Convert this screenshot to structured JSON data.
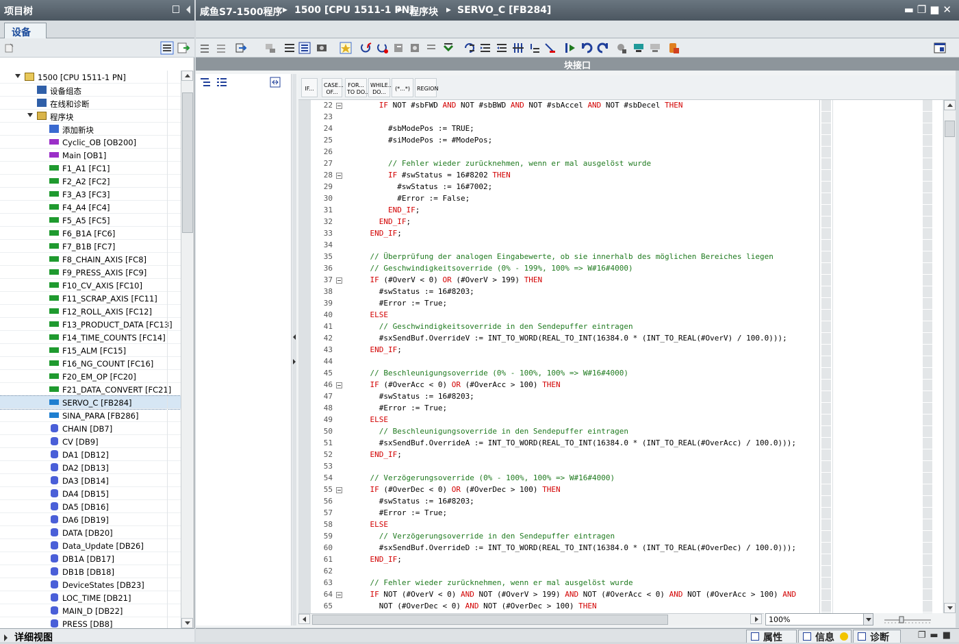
{
  "left_panel": {
    "title": "项目树",
    "tab": "设备",
    "details_label": "详细视图",
    "tree": [
      {
        "label": "1500 [CPU 1511-1 PN]",
        "level": 0,
        "icon": "plc-icon",
        "color": "#e8c85a",
        "expand": true
      },
      {
        "label": "设备组态",
        "level": 1,
        "icon": "device-config-icon",
        "color": "#2f5fa8"
      },
      {
        "label": "在线和诊断",
        "level": 1,
        "icon": "online-diag-icon",
        "color": "#2f5fa8"
      },
      {
        "label": "程序块",
        "level": 1,
        "icon": "folder-icon",
        "color": "#d9b44a",
        "expand": true
      },
      {
        "label": "添加新块",
        "level": 2,
        "icon": "add-block-icon",
        "color": "#3a6ad0"
      },
      {
        "label": "Cyclic_OB [OB200]",
        "level": 2,
        "icon": "ob-icon",
        "color": "#9b2fc8"
      },
      {
        "label": "Main [OB1]",
        "level": 2,
        "icon": "ob-icon",
        "color": "#9b2fc8"
      },
      {
        "label": "F1_A1 [FC1]",
        "level": 2,
        "icon": "fc-icon",
        "color": "#1f9a2f"
      },
      {
        "label": "F2_A2 [FC2]",
        "level": 2,
        "icon": "fc-icon",
        "color": "#1f9a2f"
      },
      {
        "label": "F3_A3 [FC3]",
        "level": 2,
        "icon": "fc-icon",
        "color": "#1f9a2f"
      },
      {
        "label": "F4_A4 [FC4]",
        "level": 2,
        "icon": "fc-icon",
        "color": "#1f9a2f"
      },
      {
        "label": "F5_A5 [FC5]",
        "level": 2,
        "icon": "fc-icon",
        "color": "#1f9a2f"
      },
      {
        "label": "F6_B1A [FC6]",
        "level": 2,
        "icon": "fc-icon",
        "color": "#1f9a2f"
      },
      {
        "label": "F7_B1B [FC7]",
        "level": 2,
        "icon": "fc-icon",
        "color": "#1f9a2f"
      },
      {
        "label": "F8_CHAIN_AXIS [FC8]",
        "level": 2,
        "icon": "fc-icon",
        "color": "#1f9a2f"
      },
      {
        "label": "F9_PRESS_AXIS [FC9]",
        "level": 2,
        "icon": "fc-icon",
        "color": "#1f9a2f"
      },
      {
        "label": "F10_CV_AXIS [FC10]",
        "level": 2,
        "icon": "fc-icon",
        "color": "#1f9a2f"
      },
      {
        "label": "F11_SCRAP_AXIS [FC11]",
        "level": 2,
        "icon": "fc-icon",
        "color": "#1f9a2f"
      },
      {
        "label": "F12_ROLL_AXIS [FC12]",
        "level": 2,
        "icon": "fc-icon",
        "color": "#1f9a2f"
      },
      {
        "label": "F13_PRODUCT_DATA [FC13]",
        "level": 2,
        "icon": "fc-icon",
        "color": "#1f9a2f"
      },
      {
        "label": "F14_TIME_COUNTS [FC14]",
        "level": 2,
        "icon": "fc-icon",
        "color": "#1f9a2f"
      },
      {
        "label": "F15_ALM [FC15]",
        "level": 2,
        "icon": "fc-icon",
        "color": "#1f9a2f"
      },
      {
        "label": "F16_NG_COUNT [FC16]",
        "level": 2,
        "icon": "fc-icon",
        "color": "#1f9a2f"
      },
      {
        "label": "F20_EM_OP [FC20]",
        "level": 2,
        "icon": "fc-icon",
        "color": "#1f9a2f"
      },
      {
        "label": "F21_DATA_CONVERT [FC21]",
        "level": 2,
        "icon": "fc-icon",
        "color": "#1f9a2f"
      },
      {
        "label": "SERVO_C [FB284]",
        "level": 2,
        "icon": "fb-icon",
        "color": "#1f7fd0",
        "selected": true
      },
      {
        "label": "SINA_PARA [FB286]",
        "level": 2,
        "icon": "fb-icon",
        "color": "#1f7fd0"
      },
      {
        "label": "CHAIN [DB7]",
        "level": 2,
        "icon": "db-icon",
        "color": "#4a5fd8"
      },
      {
        "label": "CV [DB9]",
        "level": 2,
        "icon": "db-icon",
        "color": "#4a5fd8"
      },
      {
        "label": "DA1 [DB12]",
        "level": 2,
        "icon": "db-icon",
        "color": "#4a5fd8"
      },
      {
        "label": "DA2 [DB13]",
        "level": 2,
        "icon": "db-icon",
        "color": "#4a5fd8"
      },
      {
        "label": "DA3 [DB14]",
        "level": 2,
        "icon": "db-icon",
        "color": "#4a5fd8"
      },
      {
        "label": "DA4 [DB15]",
        "level": 2,
        "icon": "db-icon",
        "color": "#4a5fd8"
      },
      {
        "label": "DA5 [DB16]",
        "level": 2,
        "icon": "db-icon",
        "color": "#4a5fd8"
      },
      {
        "label": "DA6 [DB19]",
        "level": 2,
        "icon": "db-icon",
        "color": "#4a5fd8"
      },
      {
        "label": "DATA [DB20]",
        "level": 2,
        "icon": "db-icon",
        "color": "#4a5fd8"
      },
      {
        "label": "Data_Update [DB26]",
        "level": 2,
        "icon": "db-icon",
        "color": "#4a5fd8"
      },
      {
        "label": "DB1A [DB17]",
        "level": 2,
        "icon": "db-icon",
        "color": "#4a5fd8"
      },
      {
        "label": "DB1B [DB18]",
        "level": 2,
        "icon": "db-icon",
        "color": "#4a5fd8"
      },
      {
        "label": "DeviceStates [DB23]",
        "level": 2,
        "icon": "db-icon",
        "color": "#4a5fd8"
      },
      {
        "label": "LOC_TIME [DB21]",
        "level": 2,
        "icon": "db-icon",
        "color": "#4a5fd8"
      },
      {
        "label": "MAIN_D [DB22]",
        "level": 2,
        "icon": "db-icon",
        "color": "#4a5fd8"
      },
      {
        "label": "PRESS [DB8]",
        "level": 2,
        "icon": "db-icon",
        "color": "#4a5fd8"
      }
    ]
  },
  "main_panel": {
    "breadcrumb": [
      "咸鱼S7-1500程序",
      "1500 [CPU 1511-1 PN]",
      "程序块",
      "SERVO_C [FB284]"
    ],
    "interface_bar": "块接口",
    "scl_buttons": [
      "IF...",
      "CASE...\nOF...",
      "FOR...\nTO DO...",
      "WHILE...\nDO...",
      "(*...*)",
      "REGION"
    ],
    "zoom": "100%",
    "code_lines": [
      {
        "n": "22",
        "fold": true,
        "t": "      <k>IF</k> NOT #sbFWD <k>AND</k> NOT #sbBWD <k>AND</k> NOT #sbAccel <k>AND</k> NOT #sbDecel <k>THEN</k>"
      },
      {
        "n": "23",
        "t": ""
      },
      {
        "n": "24",
        "t": "        #sbModePos := TRUE;"
      },
      {
        "n": "25",
        "t": "        #siModePos := #ModePos;"
      },
      {
        "n": "26",
        "t": ""
      },
      {
        "n": "27",
        "t": "        <c>// Fehler wieder zurücknehmen, wenn er mal ausgelöst wurde</c>"
      },
      {
        "n": "28",
        "fold": true,
        "t": "        <k>IF</k> #swStatus = 16#8202 <k>THEN</k>"
      },
      {
        "n": "29",
        "t": "          #swStatus := 16#7002;"
      },
      {
        "n": "30",
        "t": "          #Error := False;"
      },
      {
        "n": "31",
        "t": "        <k>END_IF</k>;"
      },
      {
        "n": "32",
        "t": "      <k>END_IF</k>;"
      },
      {
        "n": "33",
        "t": "    <k>END_IF</k>;"
      },
      {
        "n": "34",
        "t": ""
      },
      {
        "n": "35",
        "t": "    <c>// Überprüfung der analogen Eingabewerte, ob sie innerhalb des möglichen Bereiches liegen</c>"
      },
      {
        "n": "36",
        "t": "    <c>// Geschwindigkeitsoverride (0% - 199%, 100% => W#16#4000)</c>"
      },
      {
        "n": "37",
        "fold": true,
        "t": "    <k>IF</k> (#OverV < 0) <k>OR</k> (#OverV > 199) <k>THEN</k>"
      },
      {
        "n": "38",
        "t": "      #swStatus := 16#8203;"
      },
      {
        "n": "39",
        "t": "      #Error := True;"
      },
      {
        "n": "40",
        "t": "    <k>ELSE</k>"
      },
      {
        "n": "41",
        "t": "      <c>// Geschwindigkeitsoverride in den Sendepuffer eintragen</c>"
      },
      {
        "n": "42",
        "t": "      #sxSendBuf.OverrideV := INT_TO_WORD(REAL_TO_INT(16384.0 * (INT_TO_REAL(#OverV) / 100.0)));"
      },
      {
        "n": "43",
        "t": "    <k>END_IF</k>;"
      },
      {
        "n": "44",
        "t": ""
      },
      {
        "n": "45",
        "t": "    <c>// Beschleunigungsoverride (0% - 100%, 100% => W#16#4000)</c>"
      },
      {
        "n": "46",
        "fold": true,
        "t": "    <k>IF</k> (#OverAcc < 0) <k>OR</k> (#OverAcc > 100) <k>THEN</k>"
      },
      {
        "n": "47",
        "t": "      #swStatus := 16#8203;"
      },
      {
        "n": "48",
        "t": "      #Error := True;"
      },
      {
        "n": "49",
        "t": "    <k>ELSE</k>"
      },
      {
        "n": "50",
        "t": "      <c>// Beschleunigungsoverride in den Sendepuffer eintragen</c>"
      },
      {
        "n": "51",
        "t": "      #sxSendBuf.OverrideA := INT_TO_WORD(REAL_TO_INT(16384.0 * (INT_TO_REAL(#OverAcc) / 100.0)));"
      },
      {
        "n": "52",
        "t": "    <k>END_IF</k>;"
      },
      {
        "n": "53",
        "t": ""
      },
      {
        "n": "54",
        "t": "    <c>// Verzögerungsoverride (0% - 100%, 100% => W#16#4000)</c>"
      },
      {
        "n": "55",
        "fold": true,
        "t": "    <k>IF</k> (#OverDec < 0) <k>OR</k> (#OverDec > 100) <k>THEN</k>"
      },
      {
        "n": "56",
        "t": "      #swStatus := 16#8203;"
      },
      {
        "n": "57",
        "t": "      #Error := True;"
      },
      {
        "n": "58",
        "t": "    <k>ELSE</k>"
      },
      {
        "n": "59",
        "t": "      <c>// Verzögerungsoverride in den Sendepuffer eintragen</c>"
      },
      {
        "n": "60",
        "t": "      #sxSendBuf.OverrideD := INT_TO_WORD(REAL_TO_INT(16384.0 * (INT_TO_REAL(#OverDec) / 100.0)));"
      },
      {
        "n": "61",
        "t": "    <k>END_IF</k>;"
      },
      {
        "n": "62",
        "t": ""
      },
      {
        "n": "63",
        "t": "    <c>// Fehler wieder zurücknehmen, wenn er mal ausgelöst wurde</c>"
      },
      {
        "n": "64",
        "fold": true,
        "t": "    <k>IF</k> NOT (#OverV < 0) <k>AND</k> NOT (#OverV > 199) <k>AND</k> NOT (#OverAcc < 0) <k>AND</k> NOT (#OverAcc > 100) <k>AND</k>"
      },
      {
        "n": "65",
        "t": "      NOT (#OverDec < 0) <k>AND</k> NOT (#OverDec > 100) <k>THEN</k>"
      }
    ]
  },
  "bottom_tabs": {
    "properties": "属性",
    "info": "信息",
    "diagnostics": "诊断"
  },
  "colors": {
    "keyword": "#d20000",
    "comment": "#1f7a1f",
    "title_bar": "#55606a",
    "selection": "#d6e6f4"
  }
}
